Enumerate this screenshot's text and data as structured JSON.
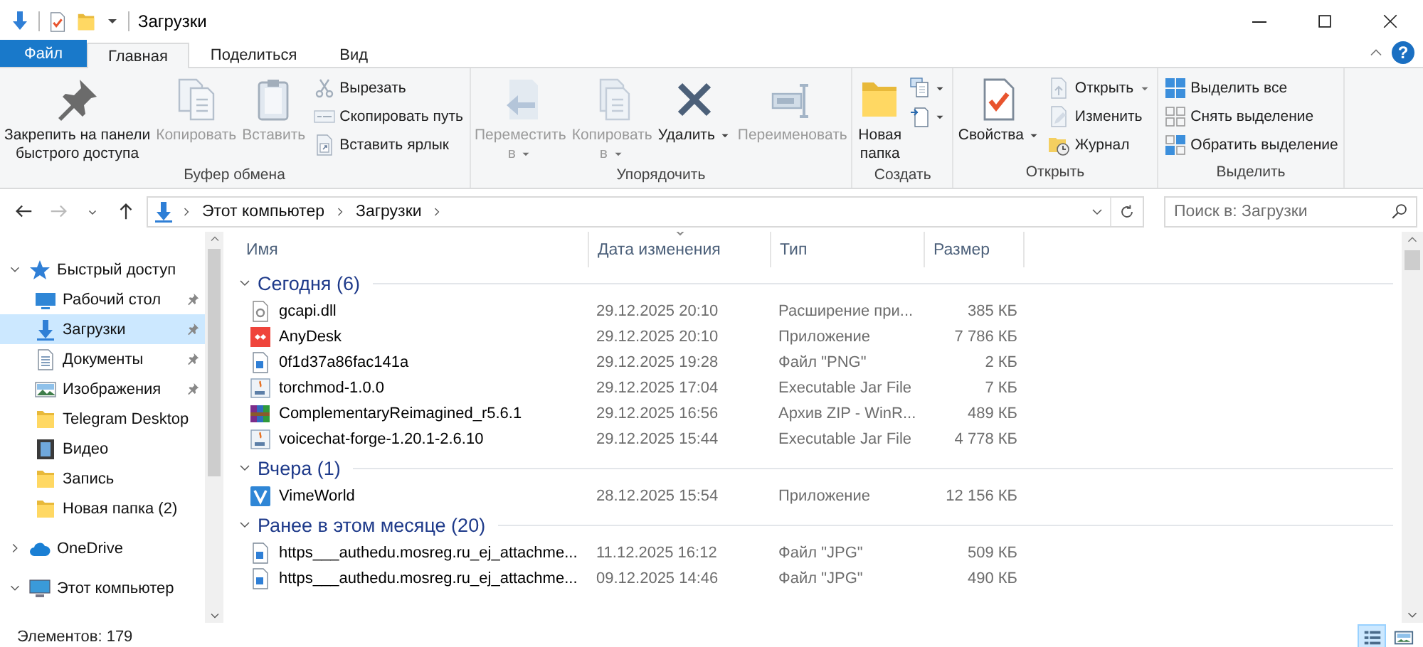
{
  "window": {
    "title": "Загрузки"
  },
  "tabs": [
    {
      "label": "Файл",
      "kind": "file",
      "selected": false
    },
    {
      "label": "Главная",
      "kind": "tab",
      "selected": true
    },
    {
      "label": "Поделиться",
      "kind": "tab",
      "selected": false
    },
    {
      "label": "Вид",
      "kind": "tab",
      "selected": false
    }
  ],
  "help": "?",
  "ribbon": {
    "groups": [
      {
        "label": "Буфер обмена",
        "large": [
          {
            "label": "Закрепить на панели\nбыстрого доступа",
            "kind": "pin",
            "disabled": false,
            "menu": false
          },
          {
            "label": "Копировать",
            "kind": "copy",
            "disabled": true,
            "menu": false
          },
          {
            "label": "Вставить",
            "kind": "paste",
            "disabled": true,
            "menu": false
          }
        ],
        "small": [
          {
            "label": "Вырезать",
            "kind": "cut",
            "disabled": true,
            "menu": false
          },
          {
            "label": "Скопировать путь",
            "kind": "copypath",
            "disabled": true,
            "menu": false
          },
          {
            "label": "Вставить ярлык",
            "kind": "shortcut",
            "disabled": true,
            "menu": false
          }
        ]
      },
      {
        "label": "Упорядочить",
        "large": [
          {
            "label": "Переместить\nв",
            "kind": "move",
            "disabled": true,
            "menu": true
          },
          {
            "label": "Копировать\nв",
            "kind": "copyto",
            "disabled": true,
            "menu": true
          },
          {
            "label": "Удалить",
            "kind": "delete",
            "disabled": false,
            "menu": true
          },
          {
            "label": "Переименовать",
            "kind": "rename",
            "disabled": true,
            "menu": false
          }
        ]
      },
      {
        "label": "Создать",
        "large": [
          {
            "label": "Новая\nпапка",
            "kind": "folder",
            "disabled": false,
            "menu": false
          }
        ],
        "small": [
          {
            "kind": "newitem",
            "disabled": false,
            "menu": true
          },
          {
            "kind": "easyaccess",
            "disabled": false,
            "menu": true
          }
        ]
      },
      {
        "label": "Открыть",
        "large": [
          {
            "label": "Свойства",
            "kind": "properties",
            "disabled": false,
            "menu": true
          }
        ],
        "small": [
          {
            "label": "Открыть",
            "kind": "open",
            "disabled": true,
            "menu": true
          },
          {
            "label": "Изменить",
            "kind": "edit",
            "disabled": true,
            "menu": false
          },
          {
            "label": "Журнал",
            "kind": "history",
            "disabled": false,
            "menu": false
          }
        ]
      },
      {
        "label": "Выделить",
        "small": [
          {
            "label": "Выделить все",
            "kind": "selectall",
            "disabled": false,
            "menu": false
          },
          {
            "label": "Снять выделение",
            "kind": "selectnone",
            "disabled": false,
            "menu": false
          },
          {
            "label": "Обратить выделение",
            "kind": "invert",
            "disabled": false,
            "menu": false
          }
        ]
      }
    ]
  },
  "address": {
    "back_enabled": true,
    "forward_enabled": false,
    "crumbs": [
      "Этот компьютер",
      "Загрузки"
    ]
  },
  "search": {
    "placeholder": "Поиск в: Загрузки"
  },
  "nav": {
    "items": [
      {
        "label": "Быстрый доступ",
        "kind": "quick",
        "expanded": true,
        "selected": false,
        "children": [
          {
            "label": "Рабочий стол",
            "kind": "desktop",
            "pinned": true,
            "selected": false
          },
          {
            "label": "Загрузки",
            "kind": "downloads",
            "pinned": true,
            "selected": true
          },
          {
            "label": "Документы",
            "kind": "docs",
            "pinned": true,
            "selected": false
          },
          {
            "label": "Изображения",
            "kind": "pictures",
            "pinned": true,
            "selected": false
          },
          {
            "label": "Telegram Desktop",
            "kind": "folder",
            "pinned": false,
            "selected": false
          },
          {
            "label": "Видео",
            "kind": "video",
            "pinned": false,
            "selected": false
          },
          {
            "label": "Запись",
            "kind": "folder",
            "pinned": false,
            "selected": false
          },
          {
            "label": "Новая папка (2)",
            "kind": "folder",
            "pinned": false,
            "selected": false
          }
        ]
      },
      {
        "label": "OneDrive",
        "kind": "cloud",
        "expanded": false,
        "selected": false
      },
      {
        "label": "Этот компьютер",
        "kind": "computer",
        "expanded": true,
        "selected": false
      }
    ]
  },
  "columns": [
    {
      "label": "Имя",
      "sorted": false
    },
    {
      "label": "Дата изменения",
      "sorted": true
    },
    {
      "label": "Тип",
      "sorted": false
    },
    {
      "label": "Размер",
      "sorted": false
    }
  ],
  "groups": [
    {
      "label": "Сегодня (6)",
      "expanded": true,
      "files": [
        {
          "name": "gcapi.dll",
          "date": "29.12.2025 20:10",
          "type": "Расширение при...",
          "size": "385 КБ",
          "kind": "dll"
        },
        {
          "name": "AnyDesk",
          "date": "29.12.2025 20:10",
          "type": "Приложение",
          "size": "7 786 КБ",
          "kind": "redapp"
        },
        {
          "name": "0f1d37a86fac141a",
          "date": "29.12.2025 19:28",
          "type": "Файл \"PNG\"",
          "size": "2 КБ",
          "kind": "image"
        },
        {
          "name": "torchmod-1.0.0",
          "date": "29.12.2025 17:04",
          "type": "Executable Jar File",
          "size": "7 КБ",
          "kind": "jar"
        },
        {
          "name": "ComplementaryReimagined_r5.6.1",
          "date": "29.12.2025 16:56",
          "type": "Архив ZIP - WinR...",
          "size": "489 КБ",
          "kind": "archive"
        },
        {
          "name": "voicechat-forge-1.20.1-2.6.10",
          "date": "29.12.2025 15:44",
          "type": "Executable Jar File",
          "size": "4 778 КБ",
          "kind": "jar"
        }
      ]
    },
    {
      "label": "Вчера (1)",
      "expanded": true,
      "files": [
        {
          "name": "VimeWorld",
          "date": "28.12.2025 15:54",
          "type": "Приложение",
          "size": "12 156 КБ",
          "kind": "blueapp"
        }
      ]
    },
    {
      "label": "Ранее в этом месяце (20)",
      "expanded": true,
      "files": [
        {
          "name": "https___authedu.mosreg.ru_ej_attachme...",
          "date": "11.12.2025 16:12",
          "type": "Файл \"JPG\"",
          "size": "509 КБ",
          "kind": "image"
        },
        {
          "name": "https___authedu.mosreg.ru_ej_attachme...",
          "date": "09.12.2025 14:46",
          "type": "Файл \"JPG\"",
          "size": "490 КБ",
          "kind": "image"
        }
      ]
    }
  ],
  "status": {
    "count": "Элементов: 179"
  },
  "views": [
    {
      "kind": "details",
      "selected": true
    },
    {
      "kind": "tiles",
      "selected": false
    }
  ]
}
